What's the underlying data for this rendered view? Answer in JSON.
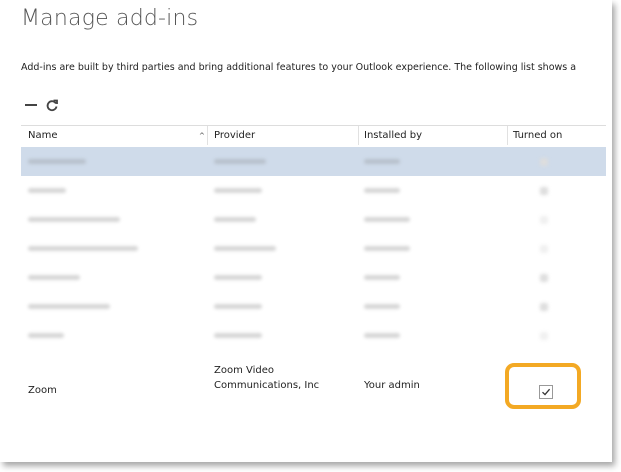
{
  "page": {
    "title": "Manage add-ins",
    "description": "Add-ins are built by third parties and bring additional features to your Outlook experience. The following list shows a"
  },
  "toolbar": {
    "minus_icon": "minus-icon",
    "refresh_icon": "refresh-icon"
  },
  "table": {
    "columns": [
      "Name",
      "Provider",
      "Installed by",
      "Turned on"
    ],
    "sort_indicator": "^",
    "rows": [
      {
        "name": "",
        "provider": "",
        "installed_by": "",
        "turned_on": true,
        "obscured": true,
        "selected": true
      },
      {
        "name": "",
        "provider": "",
        "installed_by": "",
        "turned_on": true,
        "obscured": true,
        "selected": false
      },
      {
        "name": "",
        "provider": "",
        "installed_by": "",
        "turned_on": false,
        "obscured": true,
        "selected": false
      },
      {
        "name": "",
        "provider": "",
        "installed_by": "",
        "turned_on": false,
        "obscured": true,
        "selected": false
      },
      {
        "name": "",
        "provider": "",
        "installed_by": "",
        "turned_on": true,
        "obscured": true,
        "selected": false
      },
      {
        "name": "",
        "provider": "",
        "installed_by": "",
        "turned_on": true,
        "obscured": true,
        "selected": false
      },
      {
        "name": "",
        "provider": "",
        "installed_by": "",
        "turned_on": false,
        "obscured": true,
        "selected": false
      }
    ],
    "zoom_row": {
      "name": "Zoom",
      "provider_line1": "Zoom Video",
      "provider_line2": "Communications, Inc",
      "installed_by": "Your admin",
      "turned_on": true
    }
  },
  "colors": {
    "highlight": "#f3a924",
    "selected_row": "#cfdbea"
  }
}
